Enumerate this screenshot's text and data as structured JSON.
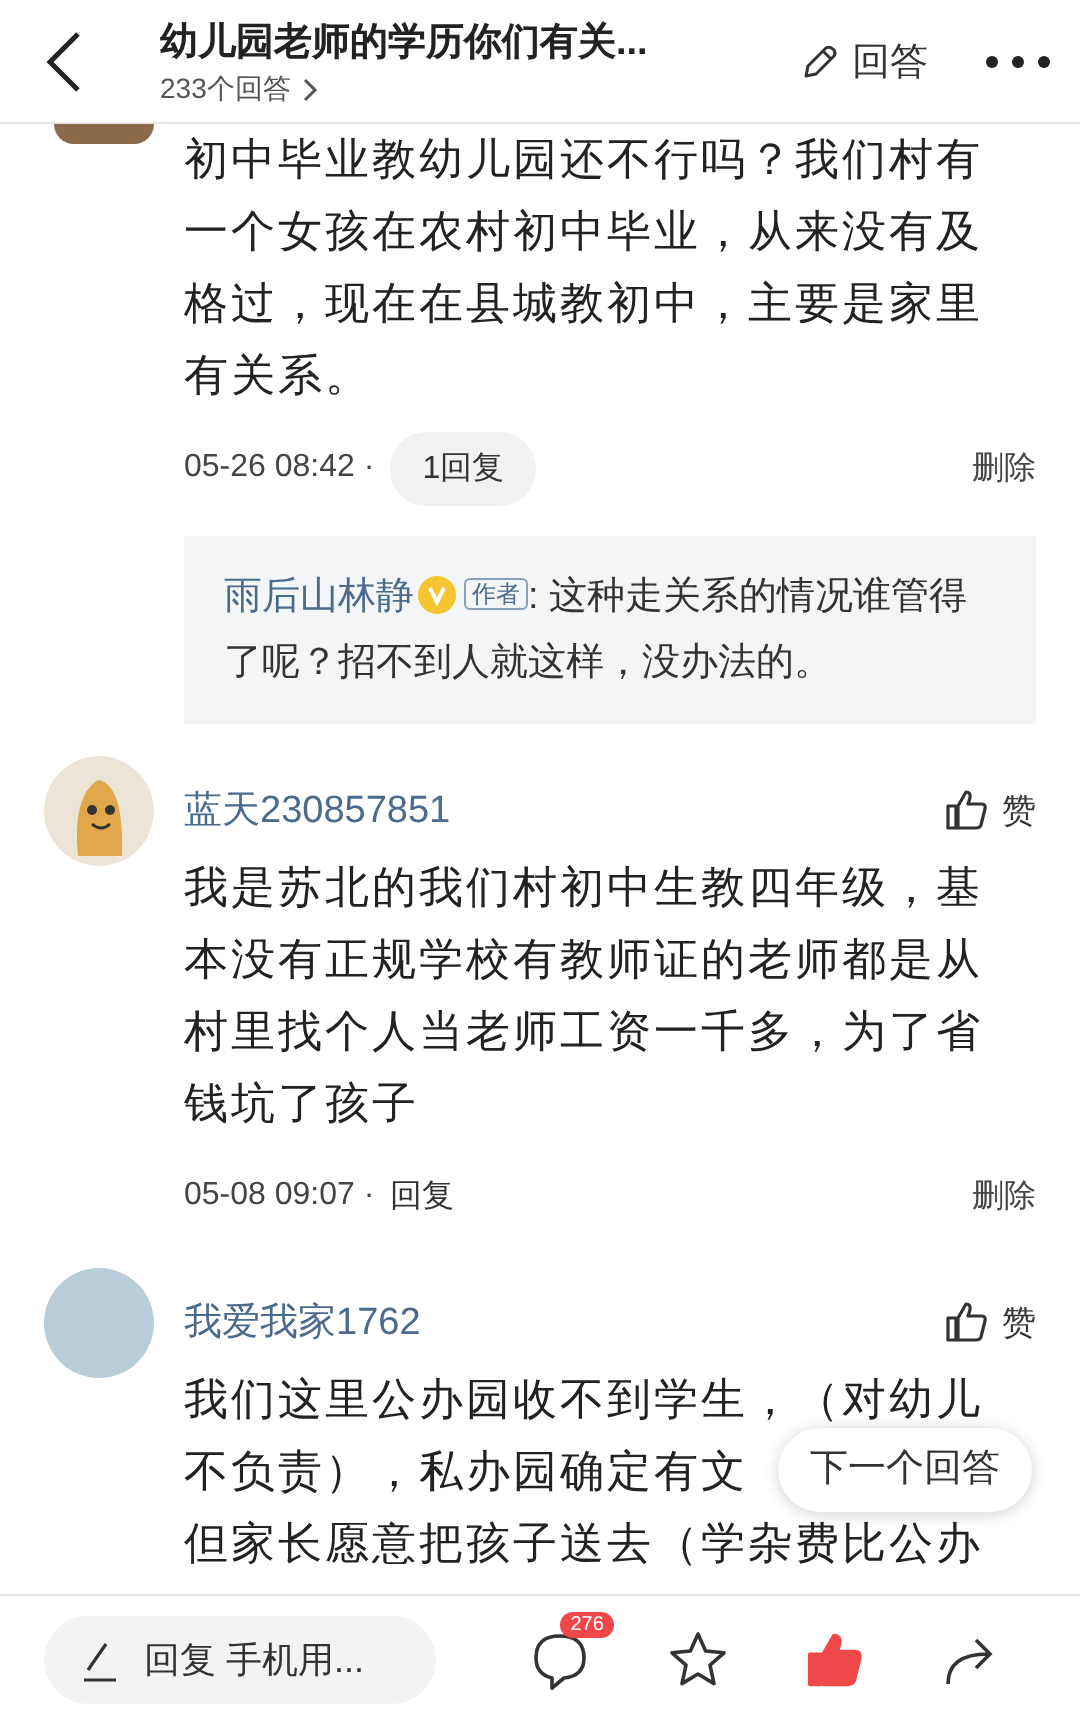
{
  "header": {
    "title": "幼儿园老师的学历你们有关...",
    "answer_count": "233个回答",
    "answer_button": "回答"
  },
  "comments": [
    {
      "kind": "photo-cut",
      "text": "初中毕业教幼儿园还不行吗？我们村有一个女孩在农村初中毕业，从来没有及格过，现在在县城教初中，主要是家里有关系。",
      "time": "05-26 08:42 ·",
      "reply_count": "1回复",
      "delete": "删除",
      "replies": [
        {
          "name": "雨后山林静",
          "verified": true,
          "tag": "作者",
          "text": ": 这种走关系的情况谁管得了呢？招不到人就这样，没办法的。"
        }
      ]
    },
    {
      "kind": "cartoon",
      "name": "蓝天230857851",
      "like": "赞",
      "text": "我是苏北的我们村初中生教四年级，基本没有正规学校有教师证的老师都是从村里找个人当老师工资一千多，为了省钱坑了孩子",
      "time": "05-08 09:07 ·",
      "reply": "回复",
      "delete": "删除"
    },
    {
      "kind": "photo",
      "name": "我爱我家1762",
      "like": "赞",
      "text_lines": [
        "我们这里公办园收不到学生，（对幼儿",
        "不负责），私办园确定有文",
        "但家长愿意把孩子送去（学杂费比公办"
      ]
    }
  ],
  "next_answer": "下一个回答",
  "bottom_bar": {
    "reply_placeholder": "回复 手机用...",
    "comment_count": "276",
    "liked": true
  }
}
